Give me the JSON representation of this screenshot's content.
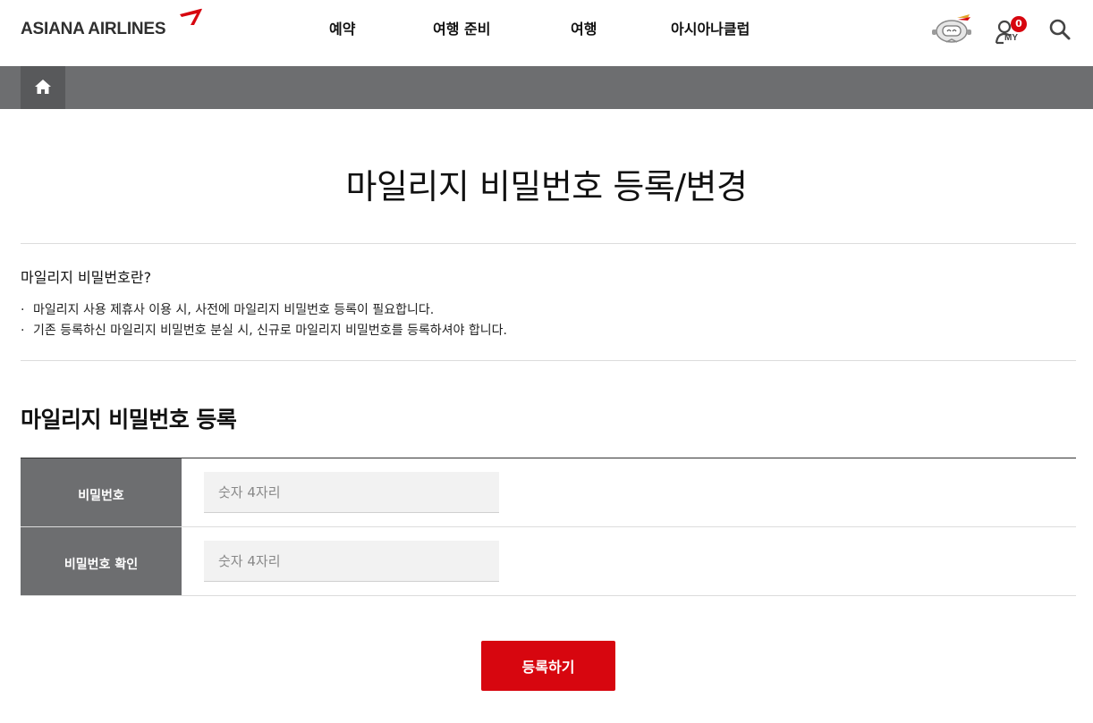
{
  "header": {
    "logo_text": "ASIANA AIRLINES",
    "nav": [
      {
        "label": "예약"
      },
      {
        "label": "여행 준비"
      },
      {
        "label": "여행"
      },
      {
        "label": "아시아나클럽"
      }
    ],
    "my_badge_count": "0",
    "my_label": "MY",
    "icons": [
      "chatbot-robot-icon",
      "my-page-icon",
      "search-icon",
      "home-icon"
    ]
  },
  "page": {
    "title": "마일리지 비밀번호 등록/변경",
    "info_title": "마일리지 비밀번호란?",
    "info_items": [
      "마일리지 사용 제휴사 이용 시, 사전에 마일리지 비밀번호 등록이 필요합니다.",
      "기존 등록하신 마일리지 비밀번호 분실 시, 신규로 마일리지 비밀번호를 등록하셔야 합니다."
    ],
    "section_title": "마일리지 비밀번호 등록"
  },
  "form": {
    "password_label": "비밀번호",
    "password_placeholder": "숫자 4자리",
    "password_value": "",
    "confirm_label": "비밀번호 확인",
    "confirm_placeholder": "숫자 4자리",
    "confirm_value": "",
    "submit_label": "등록하기"
  },
  "colors": {
    "brand_red": "#d7060f",
    "location_bar": "#6d6e70",
    "table_header": "#6d6e70"
  }
}
